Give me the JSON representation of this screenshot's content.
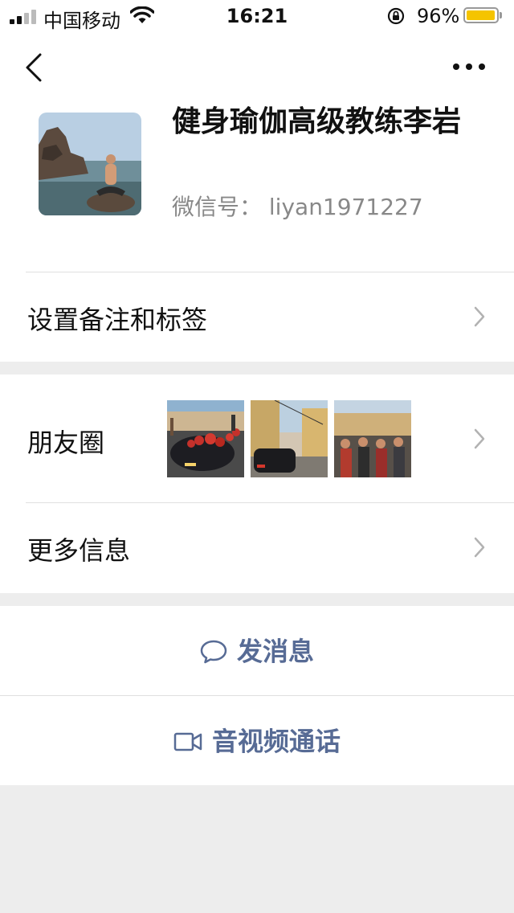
{
  "status_bar": {
    "carrier": "中国移动",
    "time": "16:21",
    "battery": "96%",
    "battery_level": 0.96
  },
  "profile": {
    "name": "健身瑜伽高级教练李岩",
    "wechat_id": "微信号： liyan1971227"
  },
  "menu": {
    "remark": "设置备注和标签",
    "moments": "朋友圈",
    "more_info": "更多信息"
  },
  "actions": {
    "message": "发消息",
    "video_call": "音视频通话"
  },
  "colors": {
    "link": "#576b95",
    "battery": "#f5c400"
  }
}
